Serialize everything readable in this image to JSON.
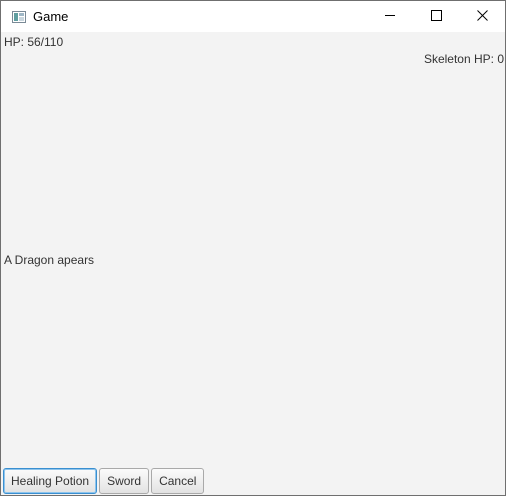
{
  "window": {
    "title": "Game",
    "icon": "java-app-icon",
    "controls": [
      "minimize-icon",
      "maximize-icon",
      "close-icon"
    ]
  },
  "status": {
    "player_hp": "HP: 56/110",
    "enemy_hp": "Skeleton HP: 0"
  },
  "message": "A Dragon apears",
  "actions": {
    "healing_potion": "Healing Potion",
    "sword": "Sword",
    "cancel": "Cancel"
  },
  "colors": {
    "background": "#f3f3f3",
    "focus_border": "#3a8fd0"
  }
}
